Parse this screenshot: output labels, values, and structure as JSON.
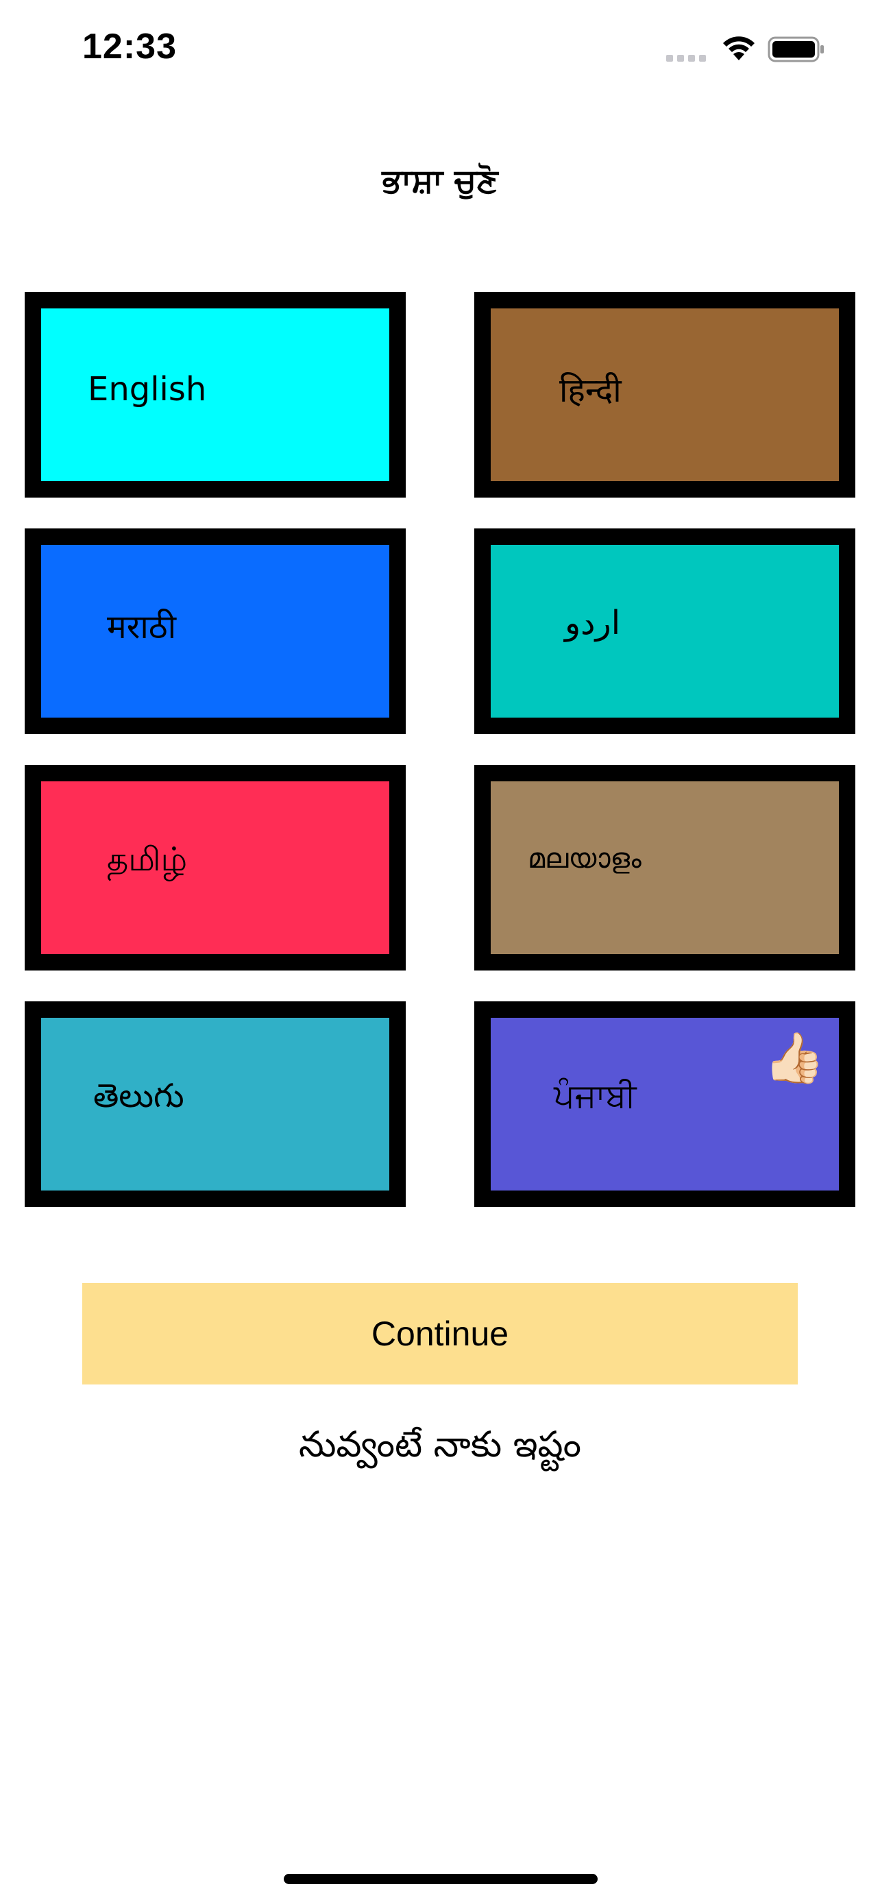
{
  "status_bar": {
    "time": "12:33",
    "icons": [
      "cellular-signal-icon",
      "wifi-icon",
      "battery-icon"
    ]
  },
  "header": {
    "title": "ਭਾਸ਼ਾ ਚੁਣੋ"
  },
  "languages": [
    {
      "label": "English",
      "color": "#00ffff",
      "selected": false
    },
    {
      "label": "हिन्दी",
      "color": "#996633",
      "selected": false
    },
    {
      "label": "मराठी",
      "color": "#0a6cff",
      "selected": false
    },
    {
      "label": "اردو",
      "color": "#00c7be",
      "selected": false
    },
    {
      "label": "தமிழ்",
      "color": "#ff2d55",
      "selected": false
    },
    {
      "label": "മലയാളം",
      "color": "#a2845e",
      "selected": false
    },
    {
      "label": "తెలుగు",
      "color": "#30b0c7",
      "selected": false
    },
    {
      "label": "ਪੰਜਾਬੀ",
      "color": "#5856d6",
      "selected": true,
      "badge_icon": "thumbs-up-icon",
      "badge_glyph": "👍🏻"
    }
  ],
  "actions": {
    "continue_label": "Continue",
    "continue_color": "#fddf8f"
  },
  "footer": {
    "text": "నువ్వంటే నాకు ఇష్టం"
  }
}
